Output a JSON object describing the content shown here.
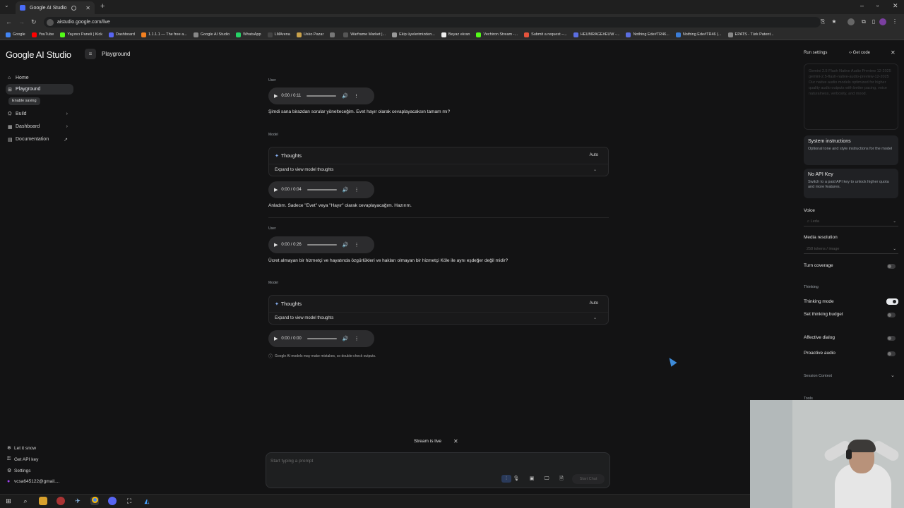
{
  "browser": {
    "tab_title": "Google AI Studio",
    "url": "aistudio.google.com/live",
    "bookmarks": [
      {
        "label": "Google",
        "color": "#4285f4"
      },
      {
        "label": "YouTube",
        "color": "#ff0000"
      },
      {
        "label": "Yayıncı Paneli | Kick",
        "color": "#53fc18"
      },
      {
        "label": "Dashboard",
        "color": "#5865f2"
      },
      {
        "label": "1.1.1.1 — The free a...",
        "color": "#f38020"
      },
      {
        "label": "Google AI Studio",
        "color": "#888888"
      },
      {
        "label": "WhatsApp",
        "color": "#25d366"
      },
      {
        "label": "LMArena",
        "color": "#444444"
      },
      {
        "label": "Usko Pazar",
        "color": "#caa24b"
      },
      {
        "label": "",
        "color": "#777777"
      },
      {
        "label": "Warframe Market |...",
        "color": "#555555"
      },
      {
        "label": "Ekip üyelerimizden...",
        "color": "#999999"
      },
      {
        "label": "Beyaz ekran",
        "color": "#eeeeee"
      },
      {
        "label": "Vechiron Stream -...",
        "color": "#53fc18"
      },
      {
        "label": "Submit a request –...",
        "color": "#e5533c"
      },
      {
        "label": "HEUMRAGE#EUW -...",
        "color": "#5b6ee1"
      },
      {
        "label": "Nothing Ede#TR46...",
        "color": "#5b6ee1"
      },
      {
        "label": "Nothing Ede#TR46 (...",
        "color": "#3b7dd8"
      },
      {
        "label": "EPATS - Türk Patent...",
        "color": "#888888"
      }
    ]
  },
  "sidebar": {
    "brand": "Google AI Studio",
    "items": [
      {
        "label": "Home",
        "icon": "home-icon",
        "glyph": "⌂"
      },
      {
        "label": "Playground",
        "icon": "playground-icon",
        "glyph": "⊞"
      },
      {
        "label": "Build",
        "icon": "build-icon",
        "glyph": "⛭"
      },
      {
        "label": "Dashboard",
        "icon": "dashboard-icon",
        "glyph": "▦"
      },
      {
        "label": "Documentation",
        "icon": "documentation-icon",
        "glyph": "▤"
      }
    ],
    "enable_saving": "Enable saving",
    "footer": [
      {
        "label": "Let it snow",
        "glyph": "❄"
      },
      {
        "label": "Get API key",
        "glyph": "⚿"
      },
      {
        "label": "Settings",
        "glyph": "⚙"
      },
      {
        "label": "vcsa645122@gmail....",
        "glyph": "●"
      }
    ]
  },
  "header": {
    "title": "Playground"
  },
  "chat": {
    "user_label": "User",
    "model_label": "Model",
    "msg1": {
      "time": "0:00 / 0:11",
      "text": "Şimdi sana birazdan sorular yönelteceğim. Evet hayır olarak cevaplayacaksın tamam mı?"
    },
    "msg2": {
      "thoughts": "Thoughts",
      "auto": "Auto",
      "expand": "Expand to view model thoughts",
      "time": "0:00 / 0:04",
      "text": "Anladım. Sadece \"Evet\" veya \"Hayır\" olarak cevaplayacağım. Hazırım."
    },
    "msg3": {
      "time": "0:00 / 0:26",
      "text": "Ücret almayan bir hizmetçi ve hayatında özgürlükleri ve hakları olmayan bir hizmetçi Köle ile aynı eşdeğer değil midir?"
    },
    "msg4": {
      "thoughts": "Thoughts",
      "auto": "Auto",
      "expand": "Expand to view model thoughts",
      "time": "0:00 / 0:00"
    },
    "disclaimer": "Google AI models may make mistakes, so double-check outputs."
  },
  "stream": {
    "status": "Stream is live",
    "placeholder": "Start typing a prompt",
    "start_label": "Start Chat"
  },
  "run_settings": {
    "title": "Run settings",
    "get_code": "Get code",
    "model_card": "Gemini 2.5 Flash Native Audio Preview 12-2025\ngemini-2.5-flash-native-audio-preview-12-2025\nOur native audio models optimized for higher quality audio outputs with better pacing, voice naturalness, verbosity, and mood.",
    "system_instructions": {
      "title": "System instructions",
      "desc": "Optional tone and style instructions for the model"
    },
    "no_api_key": {
      "title": "No API Key",
      "desc": "Switch to a paid API key to unlock higher quota and more features."
    },
    "voice_label": "Voice",
    "voice_value": "♫ Leda",
    "media_res_label": "Media resolution",
    "media_res_value": "258 tokens / image",
    "turn_coverage": "Turn coverage",
    "thinking_section": "Thinking",
    "thinking_mode": "Thinking mode",
    "thinking_budget": "Set thinking budget",
    "affective_dialog": "Affective dialog",
    "proactive_audio": "Proactive audio",
    "session_context": "Session Context",
    "tools": "Tools",
    "toggles": {
      "turn_coverage": false,
      "thinking_mode": true,
      "thinking_budget": false,
      "affective_dialog": false,
      "proactive_audio": false
    }
  }
}
